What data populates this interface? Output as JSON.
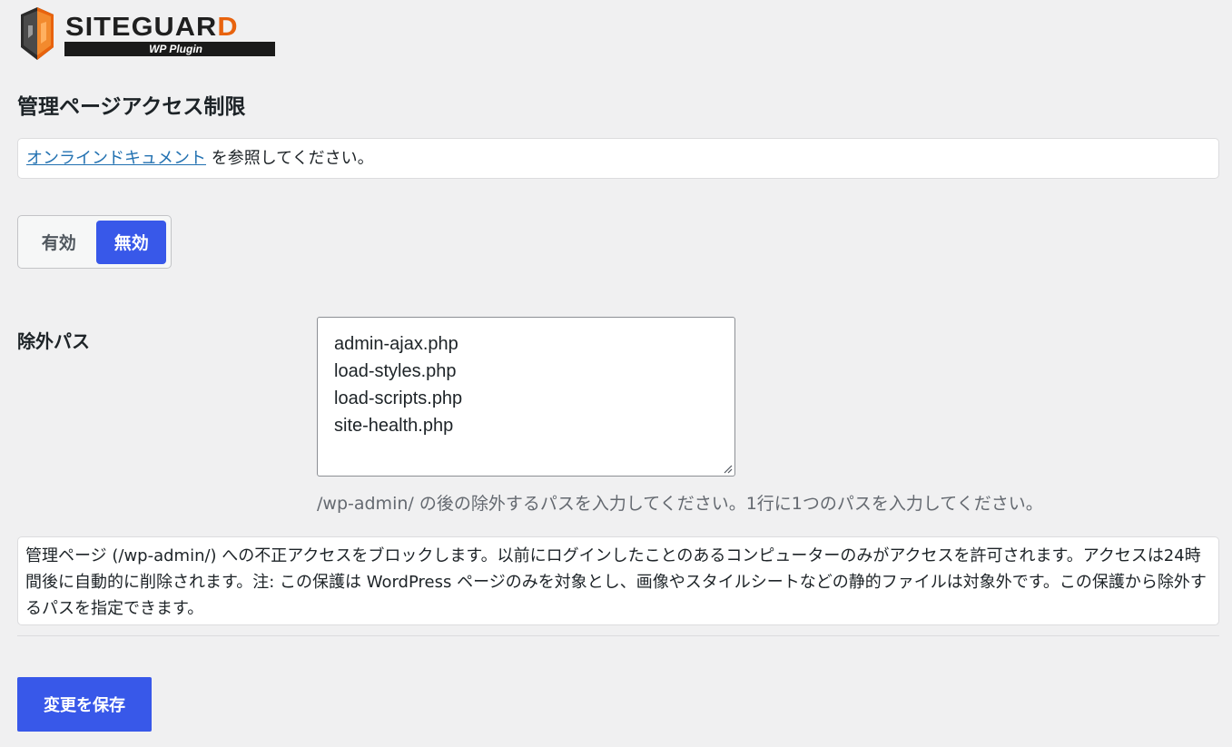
{
  "logo": {
    "word_main": "SITEGUAR",
    "word_accent": "D",
    "tagline": "WP Plugin",
    "colors": {
      "accent": "#e8630e",
      "dark": "#1a1a1a"
    }
  },
  "page": {
    "title": "管理ページアクセス制限"
  },
  "notice": {
    "link_text": "オンラインドキュメント",
    "suffix": " を参照してください。"
  },
  "toggle": {
    "on_label": "有効",
    "off_label": "無効",
    "selected": "off_label",
    "active_color": "#3858e9"
  },
  "exclude": {
    "label": "除外パス",
    "value": "admin-ajax.php\nload-styles.php\nload-scripts.php\nsite-health.php",
    "help": "/wp-admin/ の後の除外するパスを入力してください。1行に1つのパスを入力してください。"
  },
  "description": "管理ページ (/wp-admin/) への不正アクセスをブロックします。以前にログインしたことのあるコンピューターのみがアクセスを許可されます。アクセスは24時間後に自動的に削除されます。注: この保護は WordPress ページのみを対象とし、画像やスタイルシートなどの静的ファイルは対象外です。この保護から除外するパスを指定できます。",
  "actions": {
    "save_label": "変更を保存"
  }
}
